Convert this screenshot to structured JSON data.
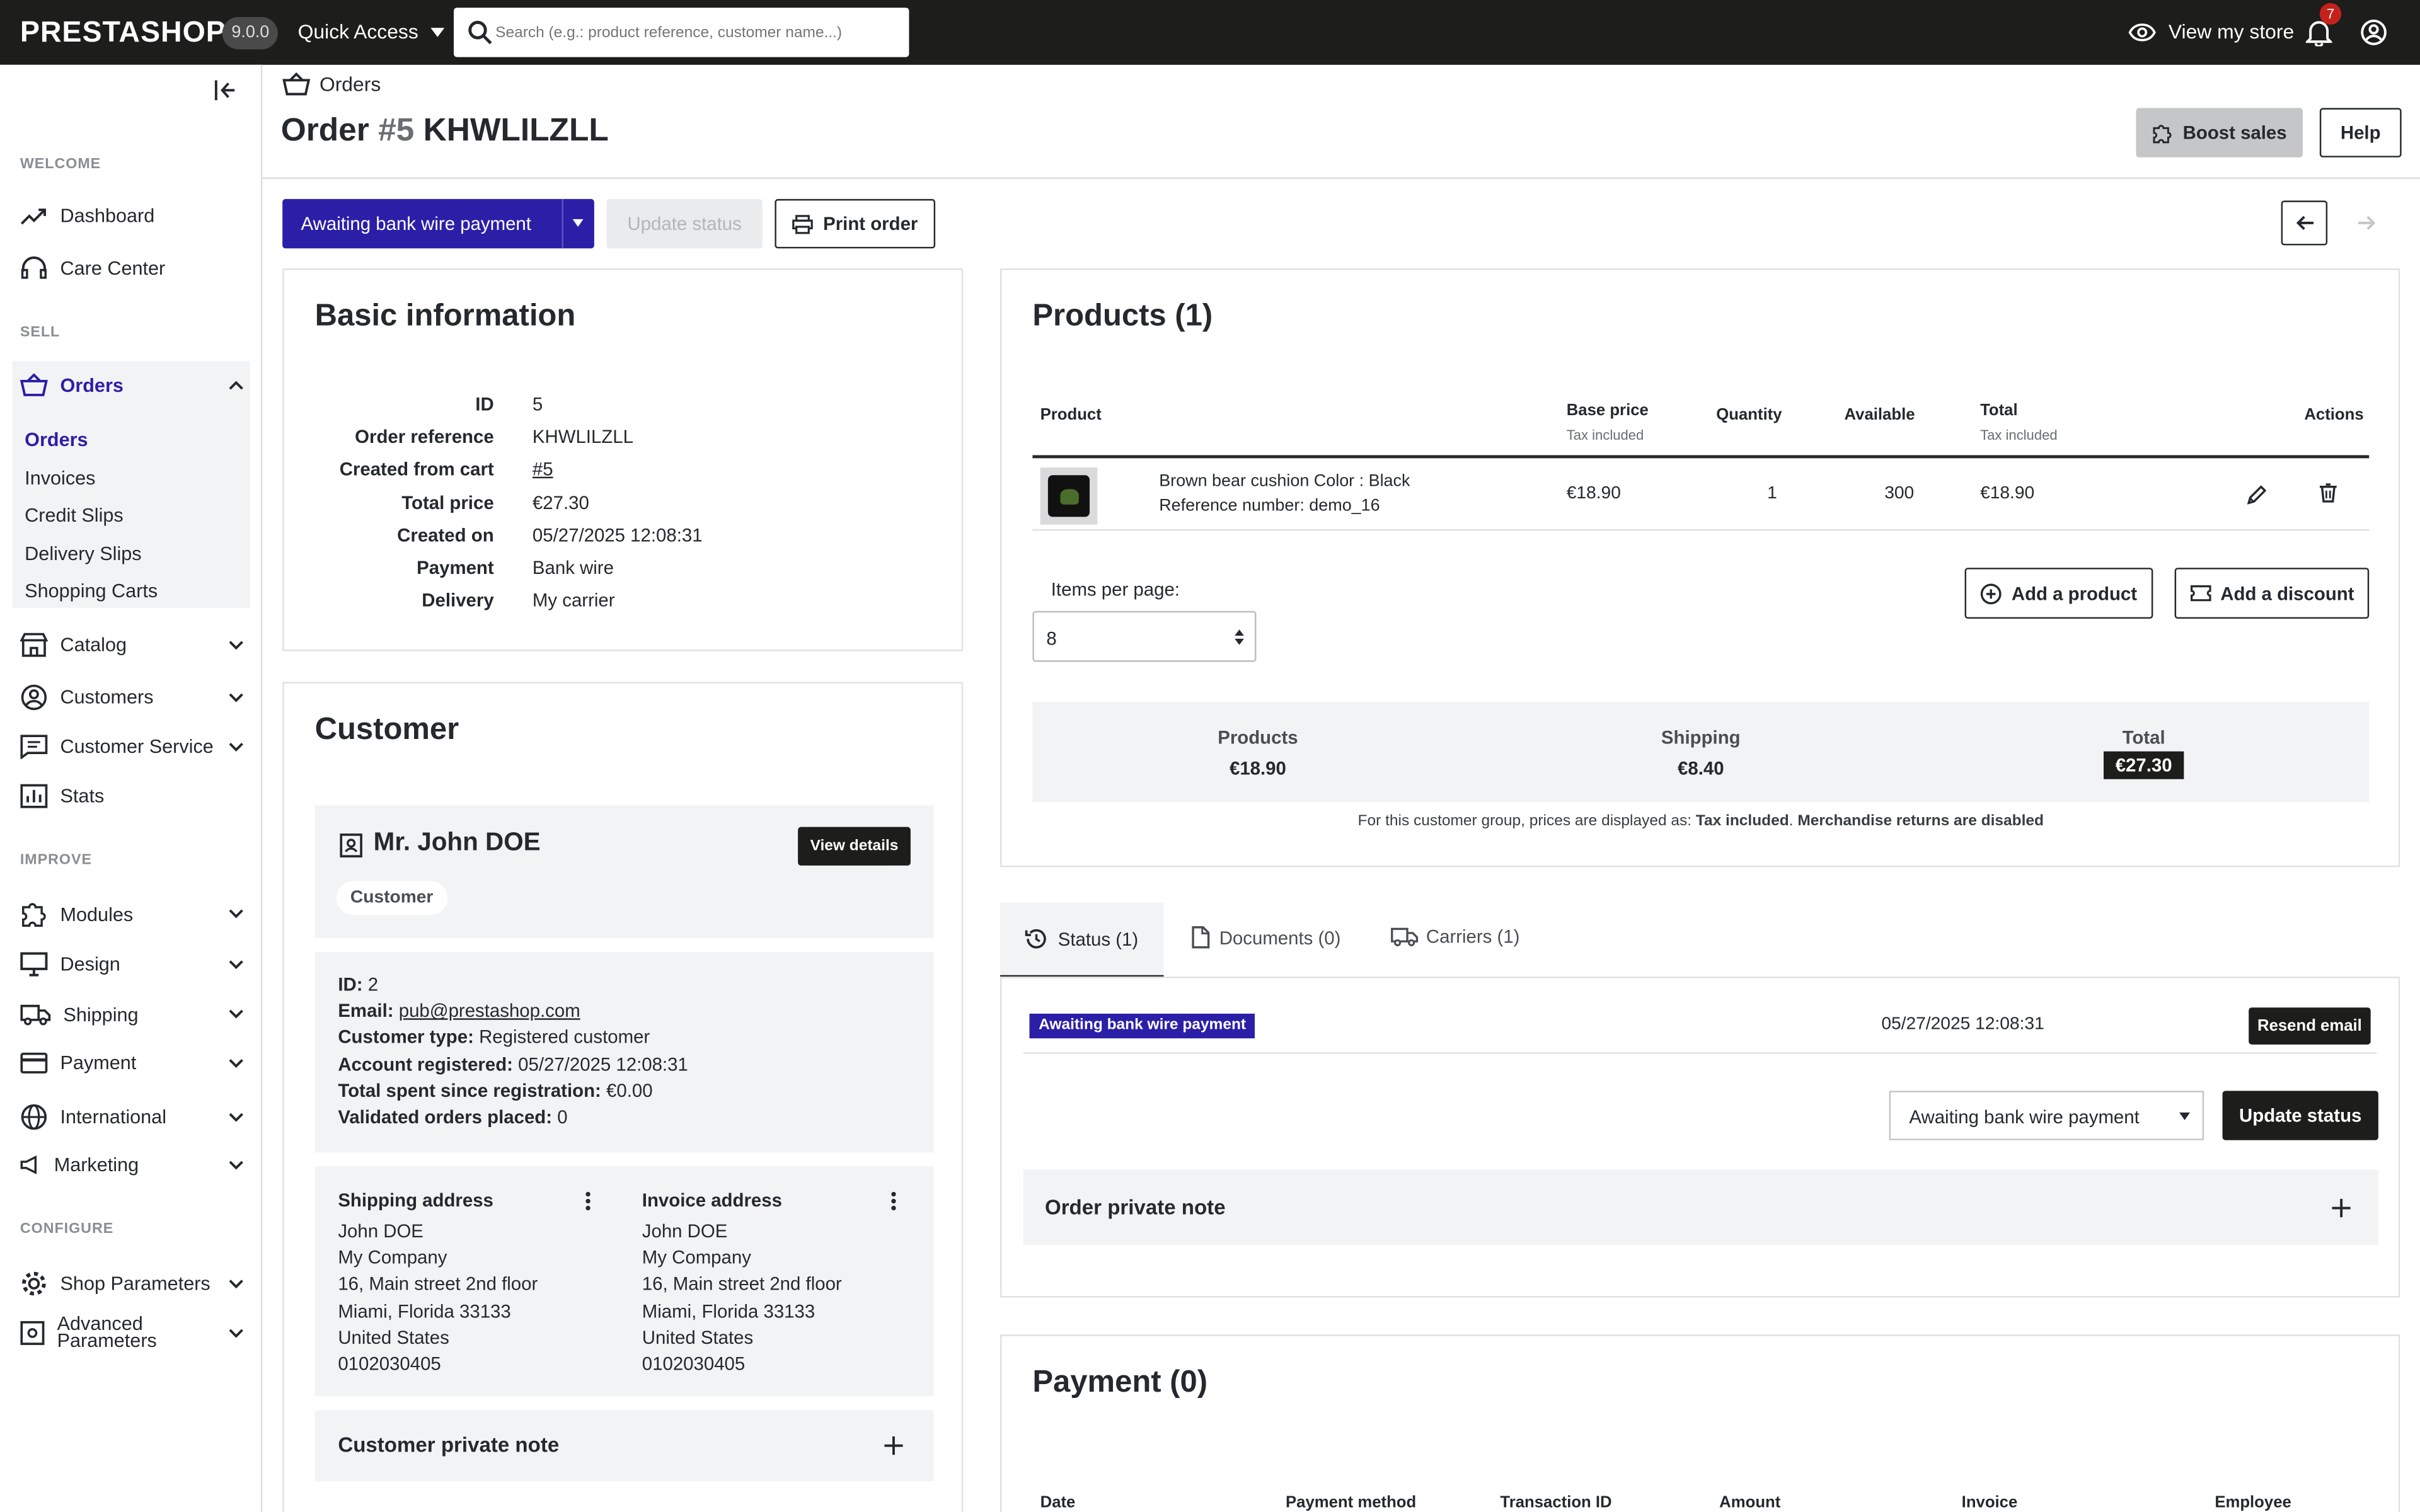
{
  "header": {
    "logo": "PRESTASHOP",
    "version": "9.0.0",
    "quick_access": "Quick Access",
    "search_placeholder": "Search (e.g.: product reference, customer name...)",
    "view_store": "View my store",
    "notifications_count": "7"
  },
  "sidebar": {
    "section_welcome": "WELCOME",
    "dashboard": "Dashboard",
    "care_center": "Care Center",
    "section_sell": "SELL",
    "orders": "Orders",
    "orders_sub": [
      "Orders",
      "Invoices",
      "Credit Slips",
      "Delivery Slips",
      "Shopping Carts"
    ],
    "catalog": "Catalog",
    "customers": "Customers",
    "customer_service": "Customer Service",
    "stats": "Stats",
    "section_improve": "IMPROVE",
    "modules": "Modules",
    "design": "Design",
    "shipping": "Shipping",
    "payment": "Payment",
    "international": "International",
    "marketing": "Marketing",
    "section_configure": "CONFIGURE",
    "shop_parameters": "Shop Parameters",
    "advanced_parameters_1": "Advanced",
    "advanced_parameters_2": "Parameters"
  },
  "page": {
    "breadcrumb": "Orders",
    "title_prefix": "Order",
    "title_number": "#5",
    "title_ref": "KHWLILZLL",
    "boost_sales": "Boost sales",
    "help": "Help"
  },
  "actions": {
    "status_select": "Awaiting bank wire payment",
    "update_status": "Update status",
    "print_order": "Print order"
  },
  "basic_info": {
    "title": "Basic information",
    "rows": [
      {
        "label": "ID",
        "value": "5"
      },
      {
        "label": "Order reference",
        "value": "KHWLILZLL"
      },
      {
        "label": "Created from cart",
        "value": "#5"
      },
      {
        "label": "Total price",
        "value": "€27.30"
      },
      {
        "label": "Created on",
        "value": "05/27/2025 12:08:31"
      },
      {
        "label": "Payment",
        "value": "Bank wire"
      },
      {
        "label": "Delivery",
        "value": "My carrier"
      }
    ]
  },
  "customer": {
    "title": "Customer",
    "name": "Mr. John DOE",
    "view_details": "View details",
    "group_badge": "Customer",
    "id_label": "ID:",
    "id_value": "2",
    "email_label": "Email:",
    "email_value": "pub@prestashop.com",
    "type_label": "Customer type:",
    "type_value": "Registered customer",
    "registered_label": "Account registered:",
    "registered_value": "05/27/2025 12:08:31",
    "spent_label": "Total spent since registration:",
    "spent_value": "€0.00",
    "validated_label": "Validated orders placed:",
    "validated_value": "0",
    "shipping_title": "Shipping address",
    "invoice_title": "Invoice address",
    "address_lines": [
      "John DOE",
      "My Company",
      "16, Main street 2nd floor",
      "Miami, Florida 33133",
      "United States",
      "0102030405"
    ],
    "private_note": "Customer private note"
  },
  "products": {
    "title": "Products (1)",
    "columns": {
      "product": "Product",
      "base_price": "Base price",
      "tax_included": "Tax included",
      "quantity": "Quantity",
      "available": "Available",
      "total": "Total",
      "actions": "Actions"
    },
    "row": {
      "name": "Brown bear cushion Color : Black",
      "reference": "Reference number: demo_16",
      "base_price": "€18.90",
      "quantity": "1",
      "available": "300",
      "total": "€18.90"
    },
    "items_per_page_label": "Items per page:",
    "items_per_page_value": "8",
    "add_product": "Add a product",
    "add_discount": "Add a discount",
    "summary": {
      "products_label": "Products",
      "products_value": "€18.90",
      "shipping_label": "Shipping",
      "shipping_value": "€8.40",
      "total_label": "Total",
      "total_value": "€27.30"
    },
    "note_prefix": "For this customer group, prices are displayed as: ",
    "note_tax": "Tax included",
    "note_returns": "Merchandise returns are disabled"
  },
  "tabs": {
    "status": "Status (1)",
    "documents": "Documents (0)",
    "carriers": "Carriers (1)"
  },
  "status_panel": {
    "badge": "Awaiting bank wire payment",
    "date": "05/27/2025 12:08:31",
    "resend_email": "Resend email",
    "select_value": "Awaiting bank wire payment",
    "update_status": "Update status",
    "private_note": "Order private note"
  },
  "payment": {
    "title": "Payment (0)",
    "columns": [
      "Date",
      "Payment method",
      "Transaction ID",
      "Amount",
      "Invoice",
      "Employee"
    ]
  },
  "colors": {
    "primary": "#2b1fa8",
    "dark": "#1d1d1b",
    "panel": "#f2f3f5"
  }
}
